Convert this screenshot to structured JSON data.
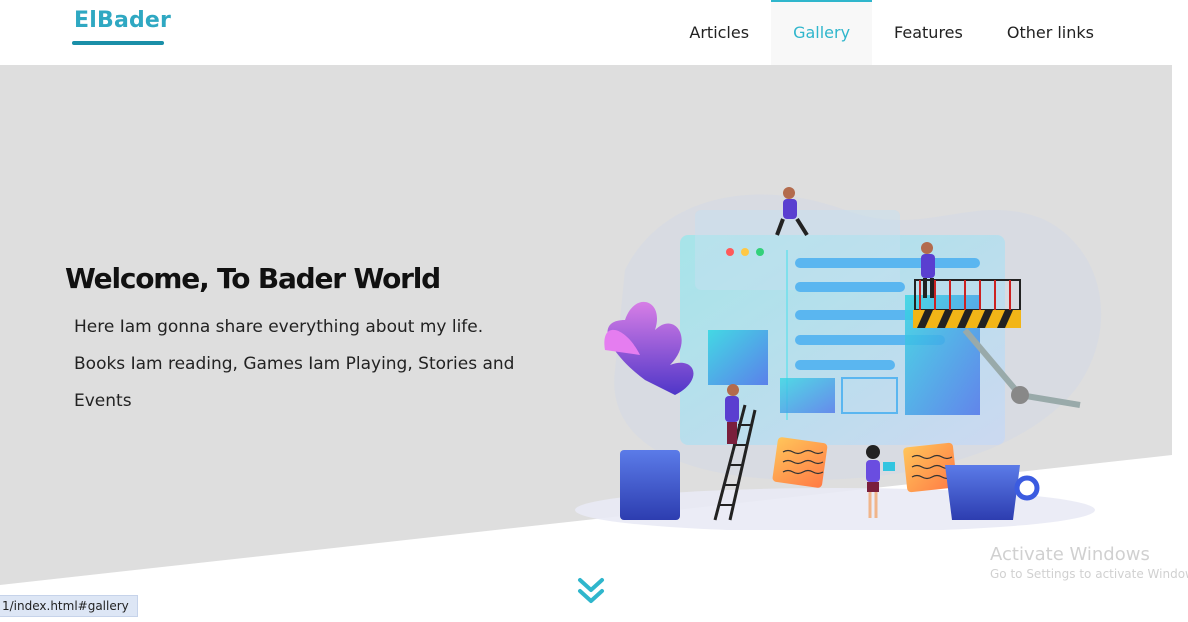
{
  "brand": {
    "name": "ElBader"
  },
  "nav": {
    "items": [
      {
        "label": "Articles",
        "active": false
      },
      {
        "label": "Gallery",
        "active": true
      },
      {
        "label": "Features",
        "active": false
      },
      {
        "label": "Other links",
        "active": false
      }
    ]
  },
  "hero": {
    "title": "Welcome, To Bader World",
    "lines": [
      "Here Iam gonna share everything about my life.",
      "Books Iam reading, Games Iam Playing, Stories and",
      "Events"
    ]
  },
  "scroll": {
    "icon": "double-chevron-down-icon"
  },
  "status_bar": {
    "url": "1/index.html#gallery"
  },
  "os_watermark": {
    "title": "Activate Windows",
    "subtitle": "Go to Settings to activate Windows."
  },
  "colors": {
    "accent": "#2fb6cc",
    "logo": "#2fa8c2",
    "hero_bg": "#dedede"
  }
}
